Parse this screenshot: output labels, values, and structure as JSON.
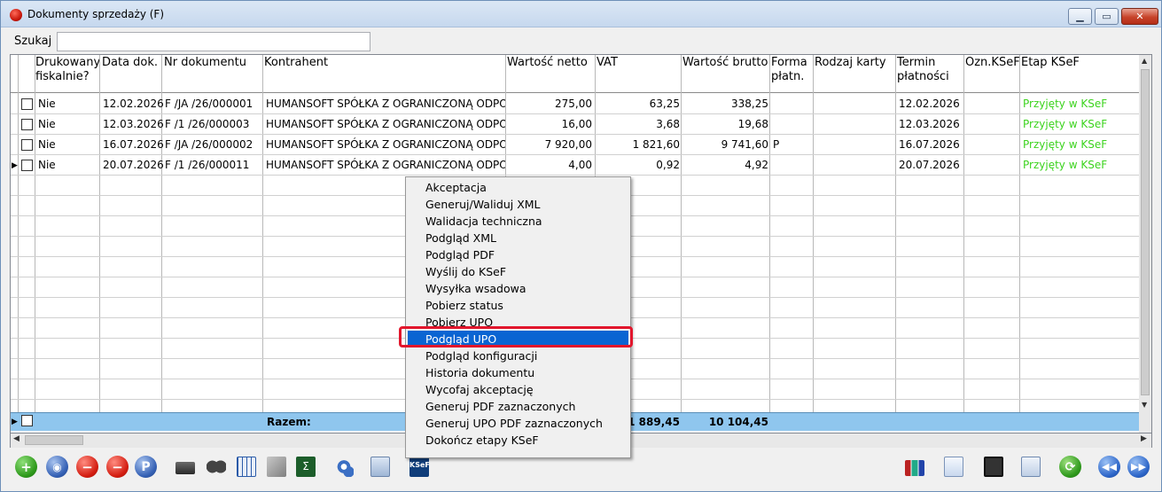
{
  "window": {
    "title": "Dokumenty sprzedaży (F)"
  },
  "search": {
    "label": "Szukaj",
    "value": ""
  },
  "columns": [
    "Drukowany\nfiskalnie?",
    "Data dok.",
    "Nr dokumentu",
    "Kontrahent",
    "Wartość netto",
    "VAT",
    "Wartość brutto",
    "Forma\npłatn.",
    "Rodzaj karty",
    "Termin\npłatności",
    "Ozn.KSeF",
    "Etap KSeF"
  ],
  "rows": [
    {
      "fiskal": "Nie",
      "data": "12.02.2026",
      "nr": "F /JA /26/000001",
      "kontrahent": "HUMANSOFT SPÓŁKA Z OGRANICZONĄ ODPOW",
      "netto": "275,00",
      "vat": "63,25",
      "brutto": "338,25",
      "forma": "",
      "karta": "",
      "termin": "12.02.2026",
      "ozn": "",
      "etap": "Przyjęty w KSeF"
    },
    {
      "fiskal": "Nie",
      "data": "12.03.2026",
      "nr": "F /1  /26/000003",
      "kontrahent": "HUMANSOFT SPÓŁKA Z OGRANICZONĄ ODPOW",
      "netto": "16,00",
      "vat": "3,68",
      "brutto": "19,68",
      "forma": "",
      "karta": "",
      "termin": "12.03.2026",
      "ozn": "",
      "etap": "Przyjęty w KSeF"
    },
    {
      "fiskal": "Nie",
      "data": "16.07.2026",
      "nr": "F /JA /26/000002",
      "kontrahent": "HUMANSOFT SPÓŁKA Z OGRANICZONĄ ODPOW",
      "netto": "7 920,00",
      "vat": "1 821,60",
      "brutto": "9 741,60",
      "forma": "P",
      "karta": "",
      "termin": "16.07.2026",
      "ozn": "",
      "etap": "Przyjęty w KSeF"
    },
    {
      "fiskal": "Nie",
      "data": "20.07.2026",
      "nr": "F /1  /26/000011",
      "kontrahent": "HUMANSOFT SPÓŁKA Z OGRANICZONĄ ODPOW",
      "netto": "4,00",
      "vat": "0,92",
      "brutto": "4,92",
      "forma": "",
      "karta": "",
      "termin": "20.07.2026",
      "ozn": "",
      "etap": "Przyjęty w KSeF"
    }
  ],
  "summary": {
    "label": "Razem:",
    "vat": "1 889,45",
    "brutto": "10 104,45"
  },
  "context_menu": {
    "items": [
      "Akceptacja",
      "Generuj/Waliduj XML",
      "Walidacja techniczna",
      "Podgląd XML",
      "Podgląd PDF",
      "Wyślij do KSeF",
      "Wysyłka wsadowa",
      "Pobierz status",
      "Pobierz UPO",
      "Podgląd UPO",
      "Podgląd konfiguracji",
      "Historia dokumentu",
      "Wycofaj akceptację",
      "Generuj PDF zaznaczonych",
      "Generuj UPO PDF zaznaczonych",
      "Dokończ etapy KSeF"
    ],
    "selected": "Podgląd UPO"
  },
  "toolbar": {
    "ksef_label": "KSeF",
    "p_label": "P"
  },
  "colors": {
    "selected": "#0a64d2",
    "status_green": "#3cd31e",
    "summary_bg": "#8fc6ee",
    "highlight": "#e2162c"
  }
}
